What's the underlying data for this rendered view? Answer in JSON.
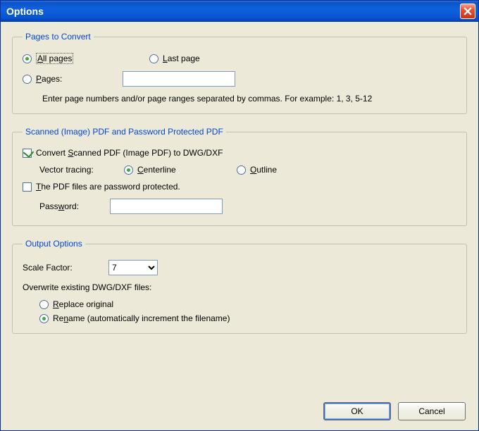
{
  "window": {
    "title": "Options"
  },
  "pages": {
    "legend": "Pages to Convert",
    "all_label": "All pages",
    "last_label": "Last page",
    "pages_label": "Pages:",
    "pages_value": "",
    "hint": "Enter page numbers and/or page ranges separated by commas. For example: 1, 3, 5-12",
    "selected": "all"
  },
  "scanned": {
    "legend": "Scanned (Image) PDF and Password Protected PDF",
    "convert_label": "Convert Scanned PDF (Image PDF) to DWG/DXF",
    "convert_checked": true,
    "tracing_label": "Vector tracing:",
    "centerline_label": "Centerline",
    "outline_label": "Outline",
    "tracing_selected": "centerline",
    "pwd_protected_label": "The PDF files are password protected.",
    "pwd_protected_checked": false,
    "password_label": "Password:",
    "password_value": ""
  },
  "output": {
    "legend": "Output Options",
    "scale_label": "Scale Factor:",
    "scale_value": "7",
    "overwrite_label": "Overwrite existing DWG/DXF files:",
    "replace_label": "Replace original",
    "rename_label": "Rename (automatically increment the filename)",
    "overwrite_selected": "rename"
  },
  "buttons": {
    "ok": "OK",
    "cancel": "Cancel"
  }
}
